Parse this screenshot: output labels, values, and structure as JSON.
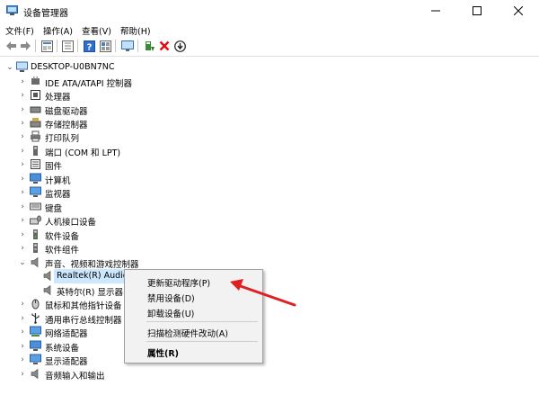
{
  "window": {
    "title": "设备管理器"
  },
  "menu": [
    {
      "label": "文件(F)"
    },
    {
      "label": "操作(A)"
    },
    {
      "label": "查看(V)"
    },
    {
      "label": "帮助(H)"
    }
  ],
  "toolbar": [
    "back-icon",
    "forward-icon",
    "properties-icon",
    "show-hide-icon",
    "help-icon",
    "view-icon",
    "monitor-icon",
    "update-driver-icon",
    "uninstall-icon",
    "install-icon"
  ],
  "tree": {
    "root": "DESKTOP-U0BN7NC",
    "categories": [
      {
        "label": "IDE ATA/ATAPI 控制器"
      },
      {
        "label": "处理器"
      },
      {
        "label": "磁盘驱动器"
      },
      {
        "label": "存储控制器"
      },
      {
        "label": "打印队列"
      },
      {
        "label": "端口 (COM 和 LPT)"
      },
      {
        "label": "固件"
      },
      {
        "label": "计算机"
      },
      {
        "label": "监视器"
      },
      {
        "label": "键盘"
      },
      {
        "label": "人机接口设备"
      },
      {
        "label": "软件设备"
      },
      {
        "label": "软件组件"
      },
      {
        "label": "声音、视频和游戏控制器"
      },
      {
        "label": "鼠标和其他指针设备"
      },
      {
        "label": "通用串行总线控制器"
      },
      {
        "label": "网络适配器"
      },
      {
        "label": "系统设备"
      },
      {
        "label": "显示适配器"
      },
      {
        "label": "音频输入和输出"
      }
    ],
    "audio_children": [
      {
        "label": "Realtek(R) Audio"
      },
      {
        "label": "英特尔(R) 显示器"
      }
    ]
  },
  "context_menu": {
    "items": [
      {
        "label": "更新驱动程序(P)"
      },
      {
        "label": "禁用设备(D)"
      },
      {
        "label": "卸载设备(U)"
      },
      {
        "label": "扫描检测硬件改动(A)"
      },
      {
        "label": "属性(R)"
      }
    ]
  },
  "colors": {
    "selection": "#cce8ff",
    "annotation_arrow": "#e02020",
    "menu_background": "#f2f2f2"
  }
}
